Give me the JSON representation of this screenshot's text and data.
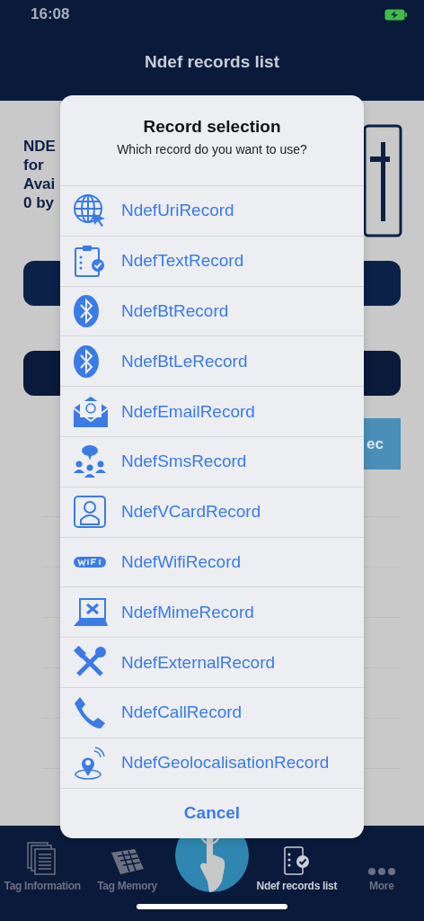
{
  "status_bar": {
    "time": "16:08"
  },
  "nav": {
    "title": "Ndef records list"
  },
  "background": {
    "info_lines": [
      "NDE",
      "for",
      "Avai",
      "0 by"
    ],
    "button_text": "ec"
  },
  "dialog": {
    "title": "Record selection",
    "message": "Which record do you want to use?",
    "options": [
      {
        "label": "NdefUriRecord",
        "kind": "globe"
      },
      {
        "label": "NdefTextRecord",
        "kind": "clipboard"
      },
      {
        "label": "NdefBtRecord",
        "kind": "bluetooth"
      },
      {
        "label": "NdefBtLeRecord",
        "kind": "bluetooth"
      },
      {
        "label": "NdefEmailRecord",
        "kind": "envelope"
      },
      {
        "label": "NdefSmsRecord",
        "kind": "people"
      },
      {
        "label": "NdefVCardRecord",
        "kind": "contact"
      },
      {
        "label": "NdefWifiRecord",
        "kind": "wifi"
      },
      {
        "label": "NdefMimeRecord",
        "kind": "laptop"
      },
      {
        "label": "NdefExternalRecord",
        "kind": "tools"
      },
      {
        "label": "NdefCallRecord",
        "kind": "phone"
      },
      {
        "label": "NdefGeolocalisationRecord",
        "kind": "pin"
      }
    ],
    "cancel": "Cancel"
  },
  "tab_bar": [
    {
      "label": "Tag Information",
      "kind": "documents",
      "selected": false
    },
    {
      "label": "Tag Memory",
      "kind": "chip",
      "selected": false
    },
    {
      "label": "Ndef records list",
      "kind": "checklist",
      "selected": true
    },
    {
      "label": "More",
      "kind": "dots",
      "selected": false
    }
  ]
}
